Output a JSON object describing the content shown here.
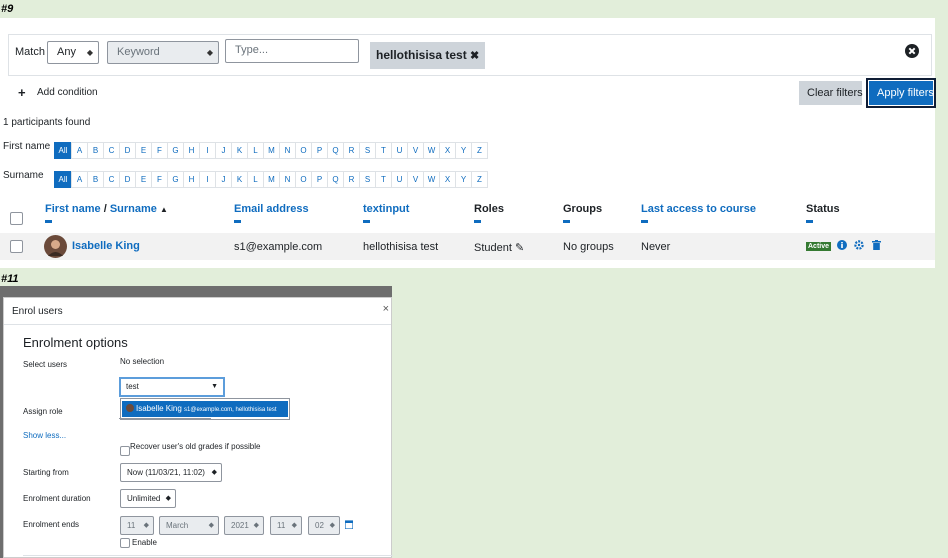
{
  "labels": {
    "section1": "#9",
    "section2": "#11"
  },
  "filters": {
    "match_label": "Match",
    "match_value": "Any",
    "type_select": "Keyword",
    "type_input_placeholder": "Type...",
    "chip_text": "hellothisisa test",
    "add_condition": "Add condition",
    "clear_filters": "Clear filters",
    "apply_filters": "Apply filters"
  },
  "participants": {
    "found_text": "1 participants found",
    "first_name_label": "First name",
    "surname_label": "Surname",
    "letters": [
      "All",
      "A",
      "B",
      "C",
      "D",
      "E",
      "F",
      "G",
      "H",
      "I",
      "J",
      "K",
      "L",
      "M",
      "N",
      "O",
      "P",
      "Q",
      "R",
      "S",
      "T",
      "U",
      "V",
      "W",
      "X",
      "Y",
      "Z"
    ],
    "columns": {
      "first_name": "First name",
      "slash": " / ",
      "surname": "Surname",
      "email": "Email address",
      "textinput": "textinput",
      "roles": "Roles",
      "groups": "Groups",
      "last_access": "Last access to course",
      "status": "Status"
    },
    "rows": [
      {
        "name": "Isabelle King",
        "email": "s1@example.com",
        "textinput": "hellothisisa test",
        "role": "Student",
        "groups": "No groups",
        "last_access": "Never",
        "status": "Active"
      }
    ]
  },
  "modal": {
    "title": "Enrol users",
    "heading": "Enrolment options",
    "select_users_label": "Select users",
    "no_selection": "No selection",
    "search_value": "test",
    "suggestion_name": "Isabelle King",
    "suggestion_detail": "s1@example.com, hellothisisa test",
    "assign_role_label": "Assign role",
    "show_less": "Show less...",
    "recover_grades": "Recover user's old grades if possible",
    "starting_from_label": "Starting from",
    "starting_from_value": "Now (11/03/21, 11:02)",
    "duration_label": "Enrolment duration",
    "duration_value": "Unlimited",
    "ends_label": "Enrolment ends",
    "ends_day": "11",
    "ends_month": "March",
    "ends_year": "2021",
    "ends_hour": "11",
    "ends_minute": "02",
    "enable_label": "Enable"
  },
  "colors": {
    "accent": "#0f6cbf",
    "active_badge": "#357a32",
    "page_bg": "#e2eeda"
  },
  "icons": [
    "times-circle-icon",
    "times-icon",
    "plus-icon",
    "sort-up-icon",
    "pencil-icon",
    "info-icon",
    "gear-icon",
    "trash-icon",
    "calendar-icon",
    "close-icon",
    "caret-down-icon"
  ]
}
